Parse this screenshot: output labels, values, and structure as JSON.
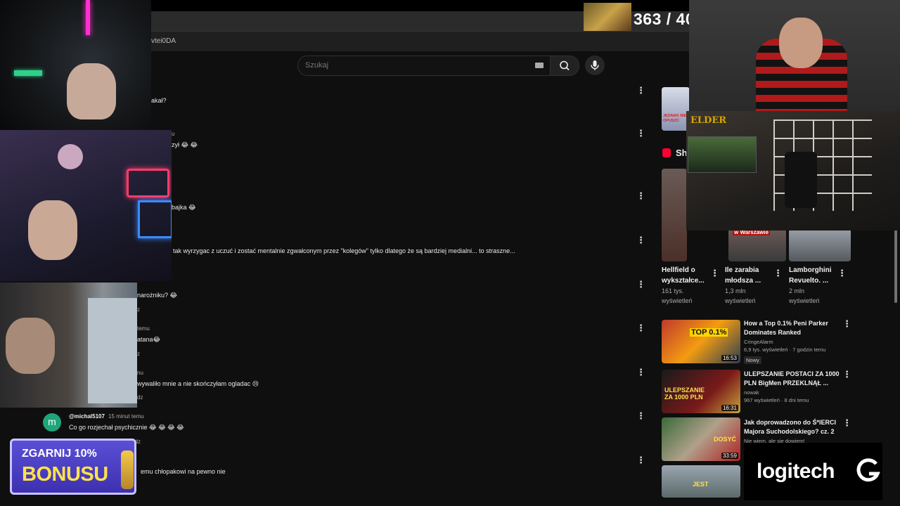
{
  "browser": {
    "address_fragment": "vtei0DA",
    "search_placeholder": "Szukaj"
  },
  "overlay": {
    "score_text": "363 / 40"
  },
  "comments": [
    {
      "text": "łakał?"
    },
    {
      "meta": "u",
      "text": "zył 😂 😂"
    },
    {
      "text": "bajka 😂"
    },
    {
      "text": "tak wyrzygac z uczuć i zostać mentalnie zgwałconym przez \"kolegów\" tylko dlatego że są bardziej medialni... to straszne..."
    },
    {
      "text": "narożniku? 😂",
      "reply": "z"
    },
    {
      "meta": "temu",
      "text": "atana😂",
      "reply": "z"
    },
    {
      "meta": "nu",
      "text": "wywaliło mnie a nie skończyłam ogladac 😢",
      "reply": "dz"
    },
    {
      "avatar_letter": "m",
      "author": "@michal5107",
      "time": "15 minut temu",
      "text": "Co go rozjechał psychicznie 😂 😂 😂 😂",
      "reply": "Odpowiedz"
    },
    {
      "text": "emu chłopakowi na pewno nie"
    }
  ],
  "sidebar": {
    "shorts_label": "Sh",
    "thumb_badges": {
      "jednak": "JEDNAK NIE OPUSZC"
    },
    "shorts": [
      {
        "title_1": "Hellfield o",
        "title_2": "wykształce...",
        "views_1": "161 tys.",
        "views_2": "wyświetleń"
      },
      {
        "title_1": "Ile zarabia",
        "title_2": "młodsza ...",
        "views_1": "1,3 mln",
        "views_2": "wyświetleń",
        "badge": "w Warszawie"
      },
      {
        "title_1": "Lamborghini",
        "title_2": "Revuelto. ...",
        "views_1": "2 mln",
        "views_2": "wyświetleń"
      }
    ],
    "videos": [
      {
        "title_1": "How a Top 0.1% Peni Parker",
        "title_2": "Dominates Ranked",
        "channel": "CringeAlarm",
        "meta": "6,9 tys. wyświetleń · 7 godzin temu",
        "badge": "Nowy",
        "duration": "16:53",
        "thumb_text": "TOP 0.1%"
      },
      {
        "title_1": "ULEPSZANIE POSTACI ZA 1000",
        "title_2": "PLN BigMen PRZEKLNĄŁ ...",
        "channel": "nowak",
        "meta": "967 wyświetleń · 8 dni temu",
        "duration": "16:31",
        "thumb_text": "ULEPSZANIE ZA 1000 PLN"
      },
      {
        "title_1": "Jak doprowadzono do Ś*IERCI",
        "title_2": "Majora Suchodolskiego? cz. 2",
        "channel": "Nie wiem, ale się dowiem!",
        "duration": "33:59",
        "thumb_text": "DOSYĆ"
      },
      {
        "thumb_text": "JEST"
      }
    ]
  },
  "streamers": {
    "elder_logo": "ELDER"
  },
  "promo": {
    "line1": "ZGARNIJ 10%",
    "line2": "BONUSU"
  },
  "sponsor": {
    "name": "logitech"
  },
  "colors": {
    "bg": "#0f0f0f",
    "promo": "#4a3fd0",
    "promo_text": "#ffe24a",
    "avatar_green": "#1fa57a"
  }
}
